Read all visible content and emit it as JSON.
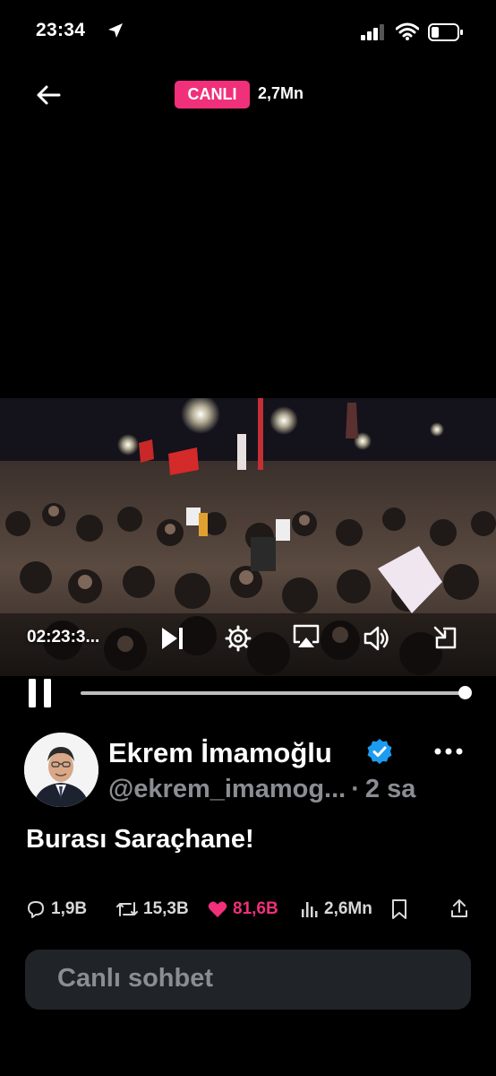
{
  "status_bar": {
    "time": "23:34"
  },
  "header": {
    "live_label": "CANLI",
    "viewer_count": "2,7Mn"
  },
  "player": {
    "time_code": "02:23:3...",
    "progress": 0.99
  },
  "tweet": {
    "display_name": "Ekrem İmamoğlu",
    "handle": "@ekrem_imamog...",
    "separator": "·",
    "age": "2 sa",
    "text": "Burası Saraçhane!"
  },
  "actions": {
    "replies": "1,9B",
    "retweets": "15,3B",
    "likes": "81,6B",
    "views": "2,6Mn"
  },
  "chat": {
    "placeholder": "Canlı sohbet"
  },
  "colors": {
    "accent": "#f0307a",
    "verified": "#1d9bf0",
    "muted": "#8a8d91",
    "chat_bg": "#202327"
  }
}
